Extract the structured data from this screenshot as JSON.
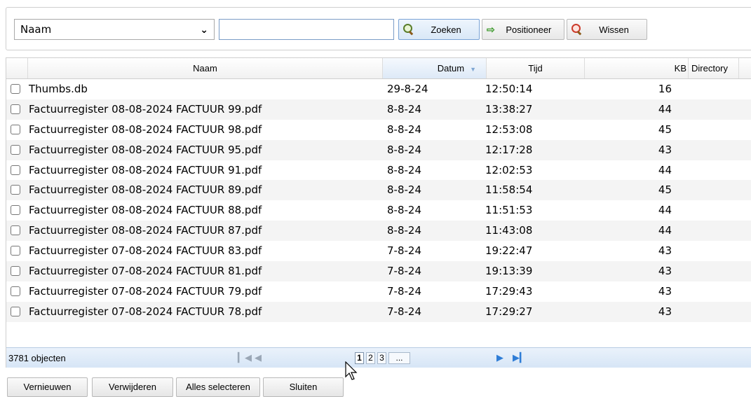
{
  "search": {
    "field_value": "Naam",
    "query_value": "",
    "search_label": "Zoeken",
    "position_label": "Positioneer",
    "clear_label": "Wissen"
  },
  "table": {
    "columns": [
      "Naam",
      "Datum",
      "Tijd",
      "KB",
      "Directory"
    ],
    "sorted_column": "Datum",
    "rows": [
      {
        "name": "Thumbs.db",
        "date": "29-8-24",
        "time": "12:50:14",
        "kb": "16"
      },
      {
        "name": "Factuurregister 08-08-2024 FACTUUR 99.pdf",
        "date": "8-8-24",
        "time": "13:38:27",
        "kb": "44"
      },
      {
        "name": "Factuurregister 08-08-2024 FACTUUR 98.pdf",
        "date": "8-8-24",
        "time": "12:53:08",
        "kb": "45"
      },
      {
        "name": "Factuurregister 08-08-2024 FACTUUR 95.pdf",
        "date": "8-8-24",
        "time": "12:17:28",
        "kb": "43"
      },
      {
        "name": "Factuurregister 08-08-2024 FACTUUR 91.pdf",
        "date": "8-8-24",
        "time": "12:02:53",
        "kb": "44"
      },
      {
        "name": "Factuurregister 08-08-2024 FACTUUR 89.pdf",
        "date": "8-8-24",
        "time": "11:58:54",
        "kb": "45"
      },
      {
        "name": "Factuurregister 08-08-2024 FACTUUR 88.pdf",
        "date": "8-8-24",
        "time": "11:51:53",
        "kb": "44"
      },
      {
        "name": "Factuurregister 08-08-2024 FACTUUR 87.pdf",
        "date": "8-8-24",
        "time": "11:43:08",
        "kb": "44"
      },
      {
        "name": "Factuurregister 07-08-2024 FACTUUR 83.pdf",
        "date": "7-8-24",
        "time": "19:22:47",
        "kb": "43"
      },
      {
        "name": "Factuurregister 07-08-2024 FACTUUR 81.pdf",
        "date": "7-8-24",
        "time": "19:13:39",
        "kb": "43"
      },
      {
        "name": "Factuurregister 07-08-2024 FACTUUR 79.pdf",
        "date": "7-8-24",
        "time": "17:29:43",
        "kb": "43"
      },
      {
        "name": "Factuurregister 07-08-2024 FACTUUR 78.pdf",
        "date": "7-8-24",
        "time": "17:29:27",
        "kb": "43"
      }
    ]
  },
  "pager": {
    "count_text": "3781 objecten",
    "pages": [
      "1",
      "2",
      "3",
      "..."
    ],
    "current_page": "1"
  },
  "actions": {
    "refresh_label": "Vernieuwen",
    "delete_label": "Verwijderen",
    "select_all_label": "Alles selecteren",
    "close_label": "Sluiten"
  },
  "colors": {
    "accent": "#2f7dd6",
    "header_sorted": "#dde9f7",
    "pager_bg": "#d6e5f6"
  }
}
